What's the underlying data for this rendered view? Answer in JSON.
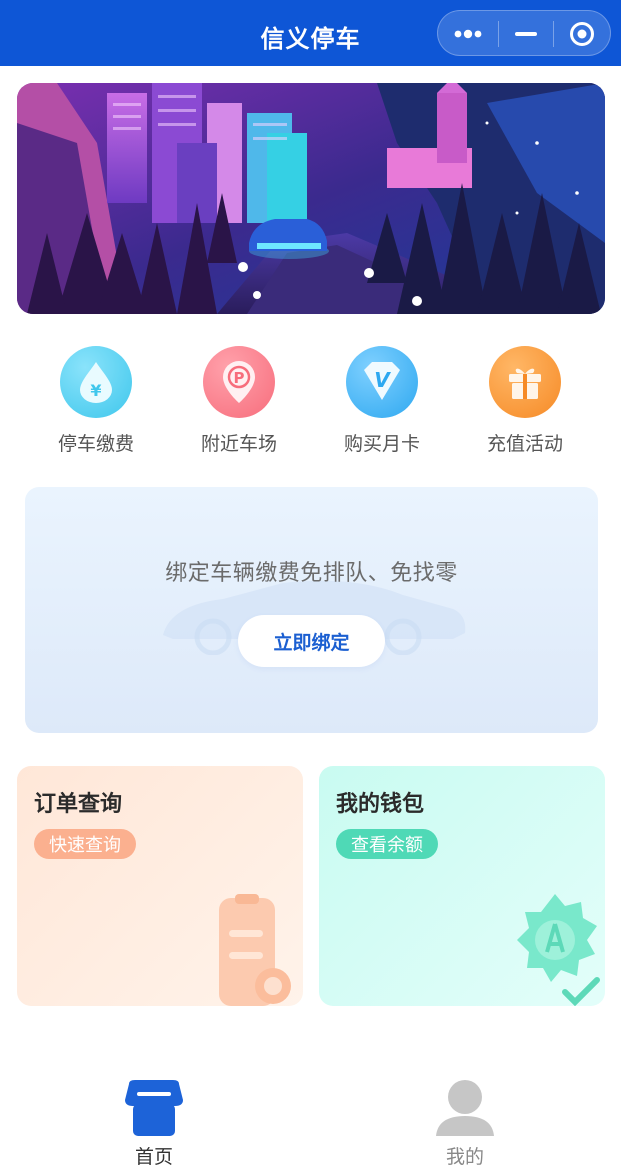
{
  "header": {
    "title": "信义停车",
    "capsule": {
      "more_icon": "more-dots-icon",
      "minimize_icon": "minimize-icon",
      "close_icon": "target-close-icon"
    }
  },
  "banner": {
    "description_icon": "city-night-car-illustration"
  },
  "quick_entries": [
    {
      "label": "停车缴费",
      "icon": "yen-drop-icon",
      "color": "#3fc7ec"
    },
    {
      "label": "附近车场",
      "icon": "parking-pin-icon",
      "color": "#f76d7c"
    },
    {
      "label": "购买月卡",
      "icon": "diamond-v-icon",
      "color": "#2ea8f0"
    },
    {
      "label": "充值活动",
      "icon": "gift-box-icon",
      "color": "#f68a26"
    }
  ],
  "bind_card": {
    "text": "绑定车辆缴费免排队、免找零",
    "button_label": "立即绑定"
  },
  "cards": {
    "orders": {
      "title": "订单查询",
      "tag": "快速查询",
      "color": "#fbb08f"
    },
    "wallet": {
      "title": "我的钱包",
      "tag": "查看余额",
      "color": "#4fd9b6"
    }
  },
  "tabbar": {
    "home": {
      "label": "首页",
      "active": true,
      "color": "#1d63d8"
    },
    "mine": {
      "label": "我的",
      "active": false,
      "color": "#888888"
    }
  }
}
